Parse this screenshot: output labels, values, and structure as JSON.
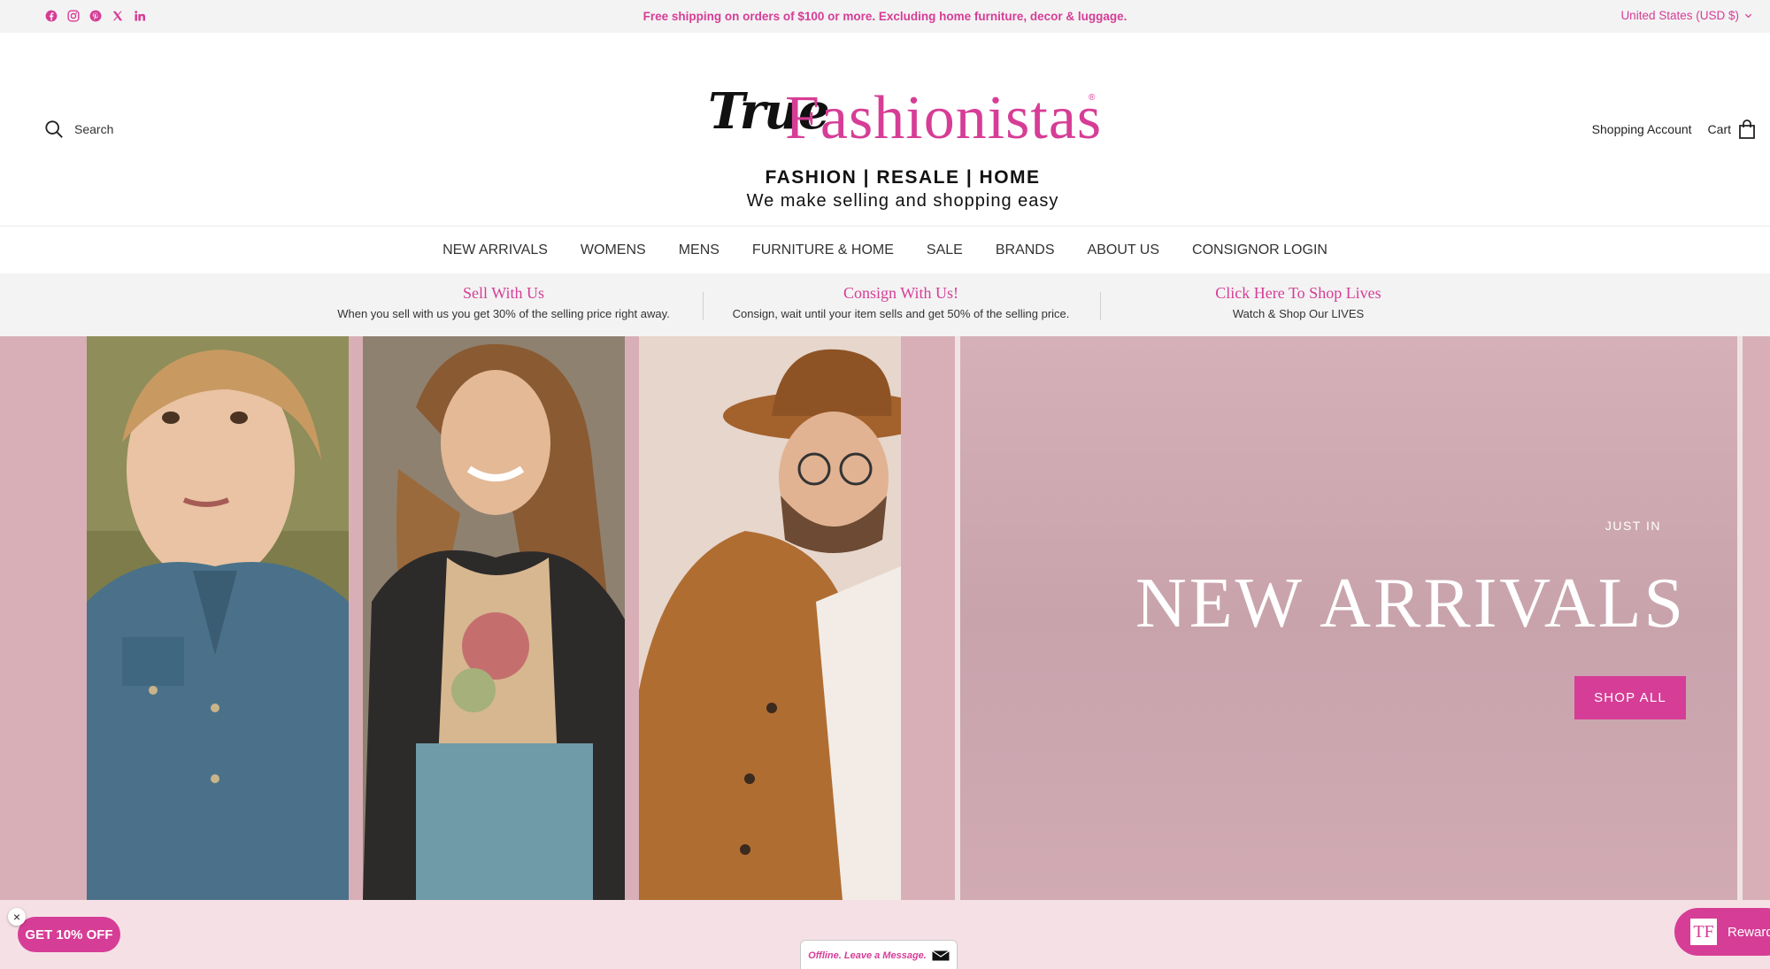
{
  "topbar": {
    "social_icons": [
      "facebook-icon",
      "instagram-icon",
      "pinterest-icon",
      "x-icon",
      "linkedin-icon"
    ],
    "announcement": "Free shipping on orders of $100 or more. Excluding home furniture, decor & luggage.",
    "currency": "United States (USD $)"
  },
  "header": {
    "search_label": "Search",
    "logo": {
      "script": "True",
      "name": "Fashionistas",
      "registered": "®",
      "tagline": "FASHION | RESALE |  HOME",
      "subtitle": "We make selling and shopping easy"
    },
    "account_label": "Shopping Account",
    "cart_label": "Cart"
  },
  "nav": {
    "items": [
      "NEW ARRIVALS",
      "WOMENS",
      "MENS",
      "FURNITURE & HOME",
      "SALE",
      "BRANDS",
      "ABOUT US",
      "CONSIGNOR LOGIN"
    ]
  },
  "promo": [
    {
      "title": "Sell With Us",
      "desc": "When you sell with us you get 30% of the selling price right away."
    },
    {
      "title": "Consign With Us!",
      "desc": "Consign, wait until your item sells and get 50% of the selling price."
    },
    {
      "title": "Click Here To Shop Lives",
      "desc": "Watch & Shop Our LIVES"
    }
  ],
  "hero": {
    "eyebrow": "JUST IN",
    "title": "NEW ARRIVALS",
    "button": "SHOP ALL"
  },
  "widgets": {
    "discount": "GET 10% OFF",
    "chat": "Offline. Leave a Message.",
    "rewards": "Rewards",
    "rewards_badge": "TF"
  },
  "colors": {
    "accent": "#d63d96",
    "hero_bg": "#d8afb7",
    "bottom_bg": "#f5e0e6"
  }
}
